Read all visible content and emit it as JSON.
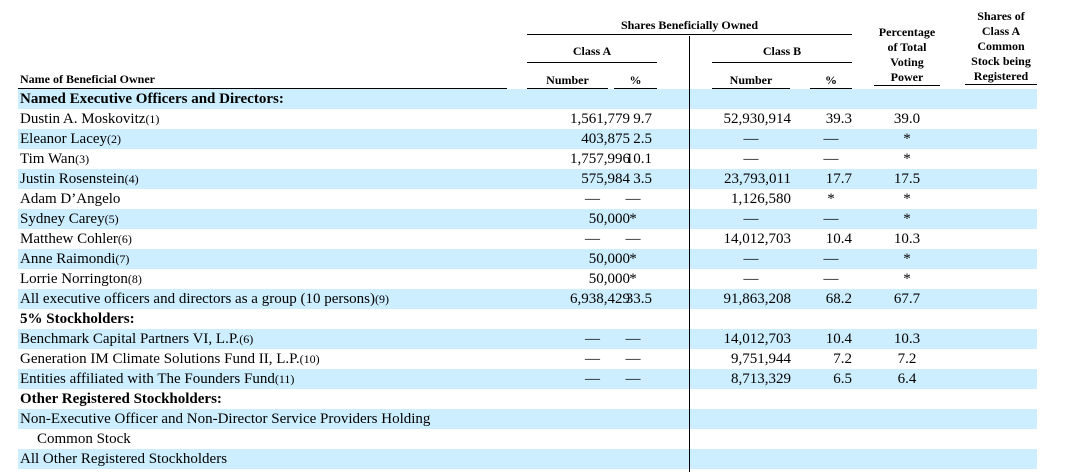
{
  "header": {
    "name_col": "Name of Beneficial Owner",
    "shares_owned": "Shares Beneficially Owned",
    "class_a": "Class A",
    "class_b": "Class B",
    "number": "Number",
    "percent": "%",
    "voting_power": [
      "Percentage",
      "of Total",
      "Voting",
      "Power"
    ],
    "registered": [
      "Shares of",
      "Class A",
      "Common",
      "Stock being",
      "Registered"
    ]
  },
  "rows": [
    {
      "type": "section",
      "name": "Named Executive Officers and Directors:",
      "fn": ""
    },
    {
      "type": "data",
      "name": "Dustin A. Moskovitz",
      "fn": "(1)",
      "a_num": "1,561,779",
      "a_pct": "9.7",
      "b_num": "52,930,914",
      "b_pct": "39.3",
      "vote": "39.0"
    },
    {
      "type": "data",
      "name": "Eleanor Lacey",
      "fn": "(2)",
      "a_num": "403,875",
      "a_pct": "2.5",
      "b_num": "—",
      "b_pct": "—",
      "vote": "*"
    },
    {
      "type": "data",
      "name": "Tim Wan",
      "fn": "(3)",
      "a_num": "1,757,996",
      "a_pct": "10.1",
      "b_num": "—",
      "b_pct": "—",
      "vote": "*"
    },
    {
      "type": "data",
      "name": "Justin Rosenstein",
      "fn": "(4)",
      "a_num": "575,984",
      "a_pct": "3.5",
      "b_num": "23,793,011",
      "b_pct": "17.7",
      "vote": "17.5"
    },
    {
      "type": "data",
      "name": "Adam D’Angelo",
      "fn": "",
      "a_num": "—",
      "a_pct": "—",
      "b_num": "1,126,580",
      "b_pct": "*",
      "vote": "*"
    },
    {
      "type": "data",
      "name": "Sydney Carey",
      "fn": "(5)",
      "a_num": "50,000",
      "a_pct": "*",
      "b_num": "—",
      "b_pct": "—",
      "vote": "*"
    },
    {
      "type": "data",
      "name": "Matthew Cohler",
      "fn": "(6)",
      "a_num": "—",
      "a_pct": "—",
      "b_num": "14,012,703",
      "b_pct": "10.4",
      "vote": "10.3"
    },
    {
      "type": "data",
      "name": "Anne Raimondi",
      "fn": "(7)",
      "a_num": "50,000",
      "a_pct": "*",
      "b_num": "—",
      "b_pct": "—",
      "vote": "*"
    },
    {
      "type": "data",
      "name": "Lorrie Norrington",
      "fn": "(8)",
      "a_num": "50,000",
      "a_pct": "*",
      "b_num": "—",
      "b_pct": "—",
      "vote": "*"
    },
    {
      "type": "data",
      "name": "All executive officers and directors as a group (10 persons)",
      "fn": "(9)",
      "a_num": "6,938,429",
      "a_pct": "33.5",
      "b_num": "91,863,208",
      "b_pct": "68.2",
      "vote": "67.7"
    },
    {
      "type": "section",
      "name": "5% Stockholders:",
      "fn": ""
    },
    {
      "type": "data",
      "name": "Benchmark Capital Partners VI, L.P.",
      "fn": "(6)",
      "a_num": "—",
      "a_pct": "—",
      "b_num": "14,012,703",
      "b_pct": "10.4",
      "vote": "10.3"
    },
    {
      "type": "data",
      "name": "Generation IM Climate Solutions Fund II, L.P.",
      "fn": "(10)",
      "a_num": "—",
      "a_pct": "—",
      "b_num": "9,751,944",
      "b_pct": "7.2",
      "vote": "7.2"
    },
    {
      "type": "data",
      "name": "Entities affiliated with The Founders Fund",
      "fn": "(11)",
      "a_num": "—",
      "a_pct": "—",
      "b_num": "8,713,329",
      "b_pct": "6.5",
      "vote": "6.4"
    },
    {
      "type": "section",
      "name": "Other Registered Stockholders:",
      "fn": ""
    },
    {
      "type": "text",
      "name": "Non-Executive Officer and Non-Director Service Providers Holding",
      "fn": ""
    },
    {
      "type": "indent",
      "name": "Common Stock",
      "fn": ""
    },
    {
      "type": "text",
      "name": "All Other Registered Stockholders",
      "fn": ""
    }
  ]
}
